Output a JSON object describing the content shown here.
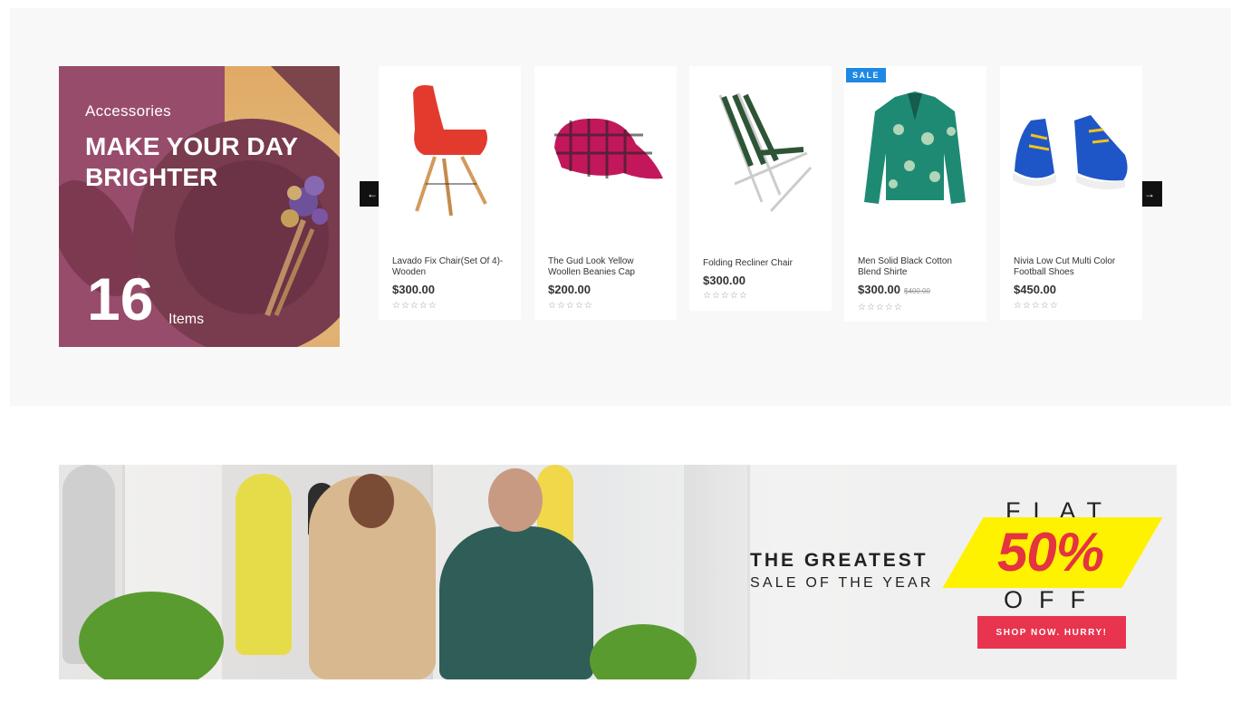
{
  "promo": {
    "kicker": "Accessories",
    "title": "MAKE YOUR DAY BRIGHTER",
    "count": "16",
    "count_label": "Items"
  },
  "carousel": {
    "prev_icon": "arrow-left-icon",
    "next_icon": "arrow-right-icon",
    "products": [
      {
        "name": "Lavado Fix Chair(Set Of 4)- Wooden",
        "price": "$300.00",
        "old_price": "",
        "sale": false,
        "rating": "☆☆☆☆☆"
      },
      {
        "name": "The Gud Look Yellow Woollen Beanies Cap",
        "price": "$200.00",
        "old_price": "",
        "sale": false,
        "rating": "☆☆☆☆☆"
      },
      {
        "name": "Folding Recliner Chair",
        "price": "$300.00",
        "old_price": "",
        "sale": false,
        "rating": "☆☆☆☆☆"
      },
      {
        "name": "Men Solid Black Cotton Blend Shirte",
        "price": "$300.00",
        "old_price": "$400.00",
        "sale": true,
        "rating": "☆☆☆☆☆"
      },
      {
        "name": "Nivia Low Cut Multi Color Football Shoes",
        "price": "$450.00",
        "old_price": "",
        "sale": false,
        "rating": "☆☆☆☆☆"
      }
    ],
    "sale_label": "SALE"
  },
  "banner": {
    "headline": "THE GREATEST",
    "subline": "SALE OF THE YEAR",
    "flat": "FLAT",
    "percent": "50%",
    "off": "OFF",
    "button": "SHOP NOW. HURRY!"
  },
  "colors": {
    "sale_badge": "#1e88e5",
    "button": "#e8344e",
    "percent": "#e53340",
    "band": "#fff200"
  }
}
